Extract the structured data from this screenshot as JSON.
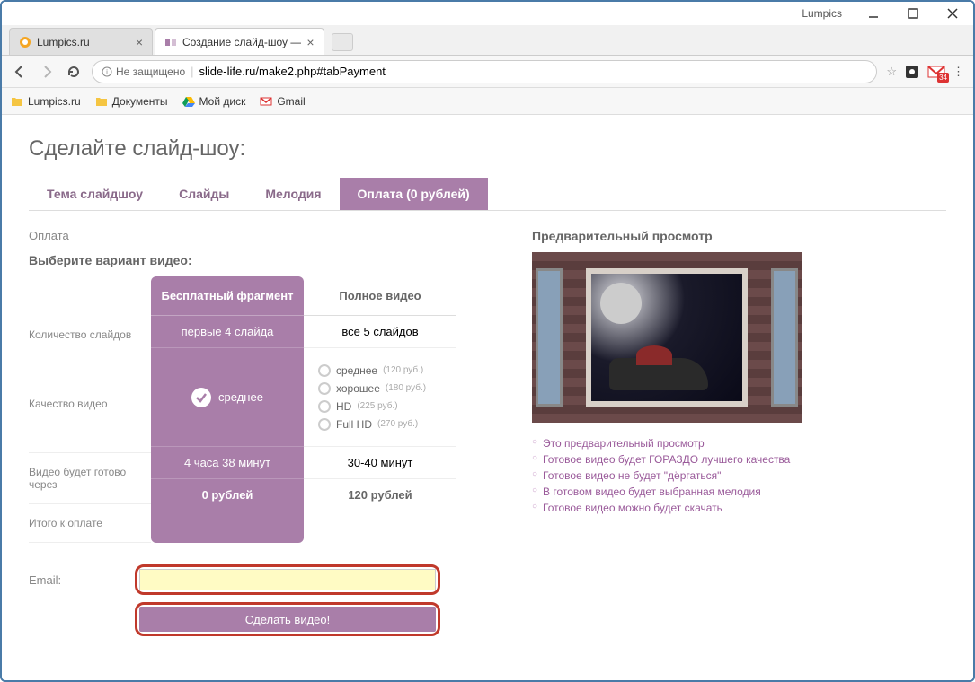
{
  "titlebar": {
    "app_name": "Lumpics"
  },
  "tabs": [
    {
      "title": "Lumpics.ru"
    },
    {
      "title": "Создание слайд-шоу —"
    }
  ],
  "addressbar": {
    "insecure_label": "Не защищено",
    "url_host": "slide-life.ru",
    "url_path": "/make2.php#tabPayment",
    "gmail_badge": "34"
  },
  "bookmarks": [
    {
      "label": "Lumpics.ru"
    },
    {
      "label": "Документы"
    },
    {
      "label": "Мой диск"
    },
    {
      "label": "Gmail"
    }
  ],
  "page": {
    "heading": "Сделайте слайд-шоу:",
    "nav_tabs": [
      {
        "label": "Тема слайдшоу"
      },
      {
        "label": "Слайды"
      },
      {
        "label": "Мелодия"
      },
      {
        "label": "Оплата (0 рублей)"
      }
    ],
    "section_title": "Оплата",
    "choose_label": "Выберите вариант видео:",
    "row_labels": {
      "slides_count": "Количество слайдов",
      "quality": "Качество видео",
      "ready_time": "Видео будет готово через",
      "total": "Итого к оплате"
    },
    "free_col": {
      "header": "Бесплатный фрагмент",
      "slides": "первые 4 слайда",
      "quality": "среднее",
      "time": "4 часа 38 минут",
      "total": "0 рублей"
    },
    "full_col": {
      "header": "Полное видео",
      "slides": "все 5 слайдов",
      "qualities": [
        {
          "label": "среднее",
          "price": "(120 руб.)"
        },
        {
          "label": "хорошее",
          "price": "(180 руб.)"
        },
        {
          "label": "HD",
          "price": "(225 руб.)"
        },
        {
          "label": "Full HD",
          "price": "(270 руб.)"
        }
      ],
      "time": "30-40 минут",
      "total": "120 рублей"
    },
    "email_label": "Email:",
    "submit_label": "Сделать видео!",
    "preview_title": "Предварительный просмотр",
    "preview_notes": [
      "Это предварительный просмотр",
      "Готовое видео будет ГОРАЗДО лучшего качества",
      "Готовое видео не будет \"дёргаться\"",
      "В готовом видео будет выбранная мелодия",
      "Готовое видео можно будет скачать"
    ]
  }
}
